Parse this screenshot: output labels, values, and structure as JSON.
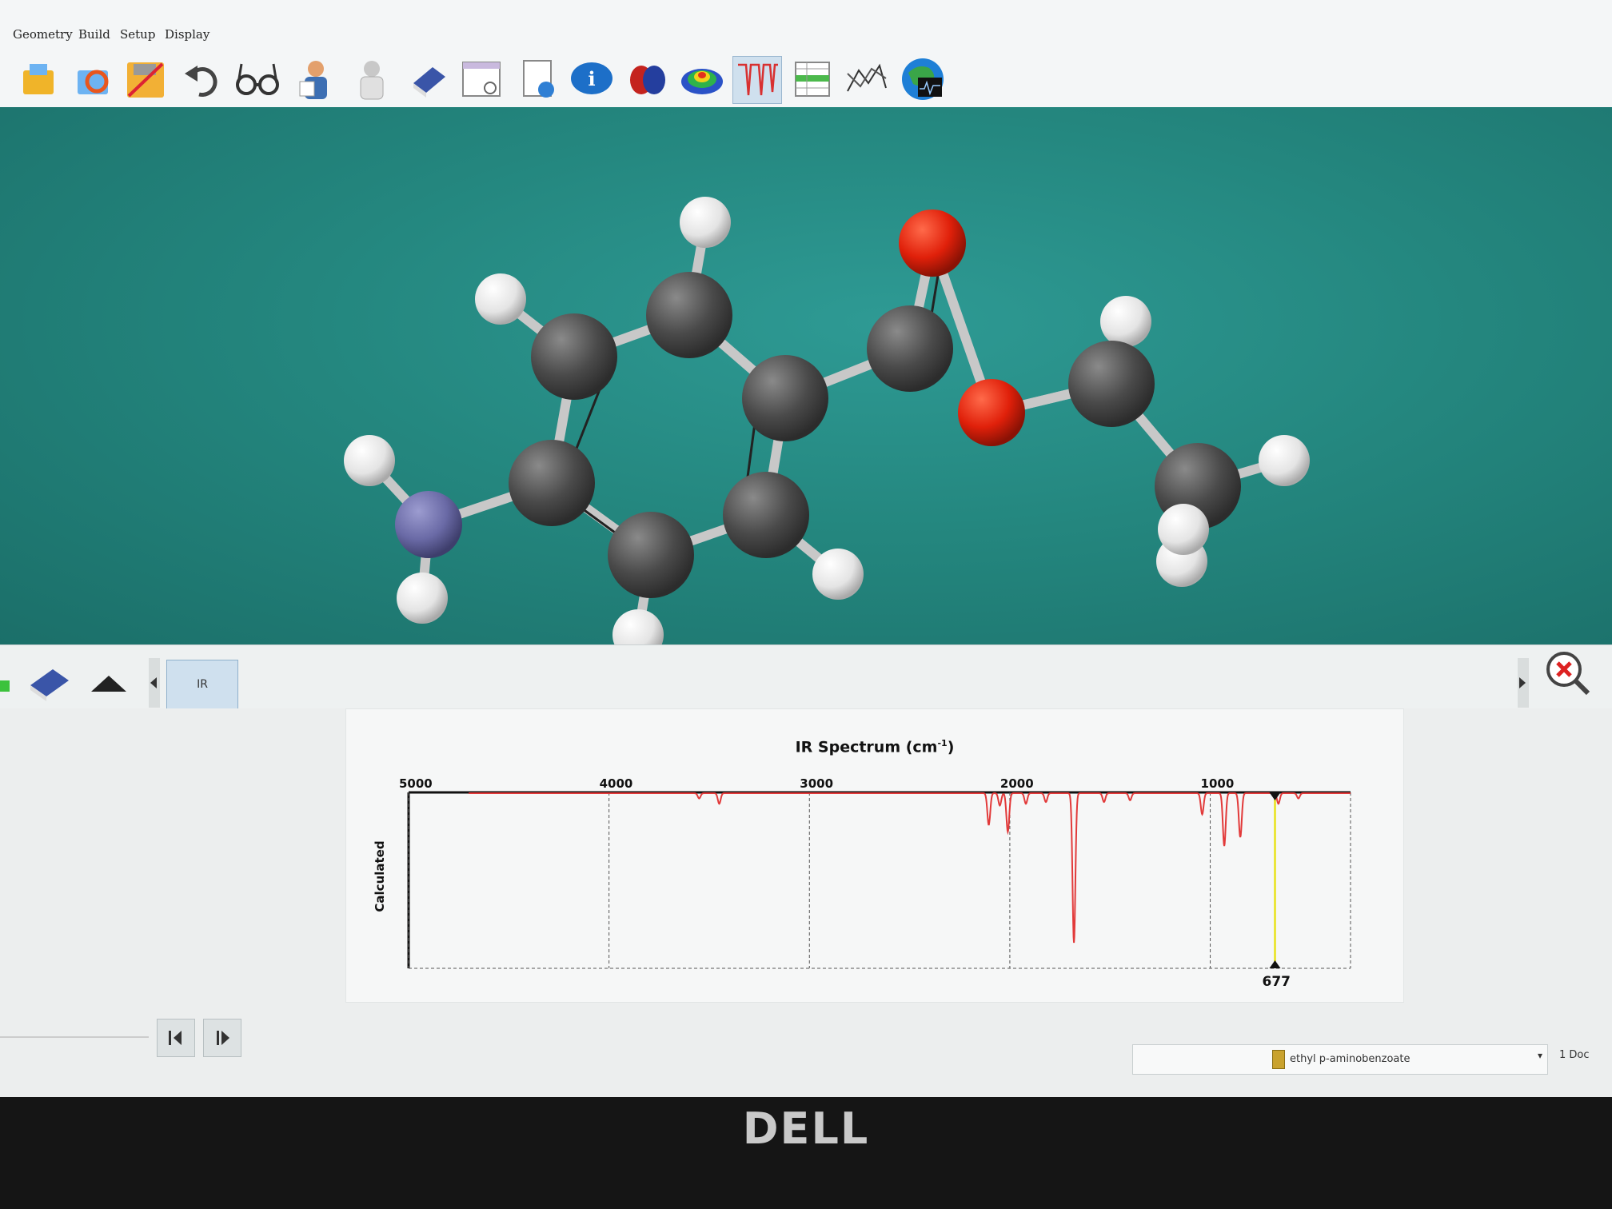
{
  "menu": {
    "items": [
      {
        "label": "Geometry"
      },
      {
        "label": "Build"
      },
      {
        "label": "Setup"
      },
      {
        "label": "Display"
      }
    ]
  },
  "toolbar": {
    "icons": [
      "open-file-icon",
      "recent-files-icon",
      "save-icon",
      "undo-icon",
      "glasses-icon",
      "calculations-icon",
      "guess-icon",
      "eraser-icon",
      "window-icon",
      "document-info-icon",
      "info-icon",
      "orbitals-icon",
      "potential-map-icon",
      "ir-spectrum-icon",
      "spreadsheet-icon",
      "plot-icon",
      "database-icon"
    ],
    "active": "ir-spectrum-icon"
  },
  "molecule": {
    "atom_colors": {
      "C": "#4a4a4a",
      "H": "#f2f2f2",
      "O": "#e0200a",
      "N": "#6a6aa6"
    }
  },
  "tabs": {
    "ir_label": "IR"
  },
  "chart_data": {
    "type": "line",
    "title": "IR Spectrum (cm",
    "title_superscript": "-1",
    "title_close": ")",
    "ylabel": "Calculated",
    "xlim": [
      5000,
      300
    ],
    "x_reversed": true,
    "ticks": [
      {
        "value": 5000,
        "label": "5000"
      },
      {
        "value": 4000,
        "label": "4000"
      },
      {
        "value": 3000,
        "label": "3000"
      },
      {
        "value": 2000,
        "label": "2000"
      },
      {
        "value": 1000,
        "label": "1000"
      }
    ],
    "cursor": {
      "value": 677,
      "label": "677"
    },
    "series": [
      {
        "color": "#e23a3a",
        "peaks": [
          {
            "x": 3550,
            "depth": 0.03
          },
          {
            "x": 3450,
            "depth": 0.06
          },
          {
            "x": 2105,
            "depth": 0.18
          },
          {
            "x": 2050,
            "depth": 0.07
          },
          {
            "x": 2010,
            "depth": 0.22
          },
          {
            "x": 1920,
            "depth": 0.06
          },
          {
            "x": 1820,
            "depth": 0.05
          },
          {
            "x": 1680,
            "depth": 0.85
          },
          {
            "x": 1530,
            "depth": 0.05
          },
          {
            "x": 1400,
            "depth": 0.04
          },
          {
            "x": 1040,
            "depth": 0.12
          },
          {
            "x": 930,
            "depth": 0.3
          },
          {
            "x": 850,
            "depth": 0.25
          },
          {
            "x": 660,
            "depth": 0.06
          },
          {
            "x": 560,
            "depth": 0.03
          }
        ]
      }
    ],
    "grid": "vertical-dashed"
  },
  "status": {
    "document_name": "ethyl p-aminobenzoate",
    "doc_count": "1 Doc"
  },
  "brand": {
    "name": "DELL"
  }
}
